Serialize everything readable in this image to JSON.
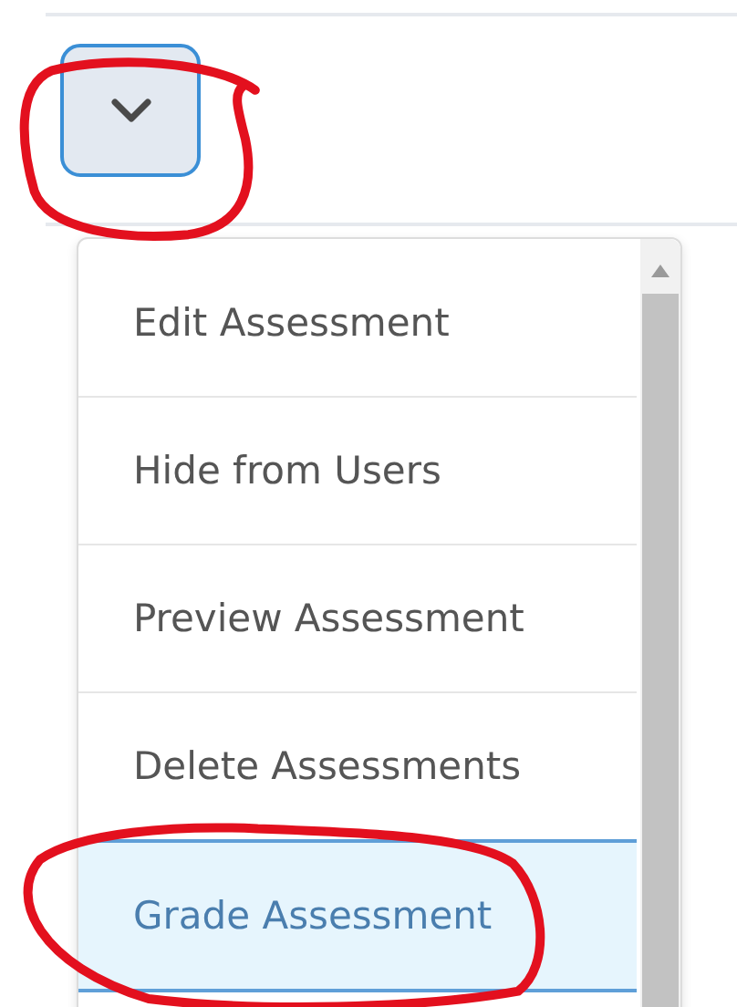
{
  "menu_button": {
    "circled": true
  },
  "menu": {
    "items": [
      {
        "label": "Edit Assessment",
        "selected": false,
        "circled": false
      },
      {
        "label": "Hide from Users",
        "selected": false,
        "circled": false
      },
      {
        "label": "Preview Assessment",
        "selected": false,
        "circled": false
      },
      {
        "label": "Delete Assessments",
        "selected": false,
        "circled": false
      },
      {
        "label": "Grade Assessment",
        "selected": true,
        "circled": true
      }
    ]
  }
}
